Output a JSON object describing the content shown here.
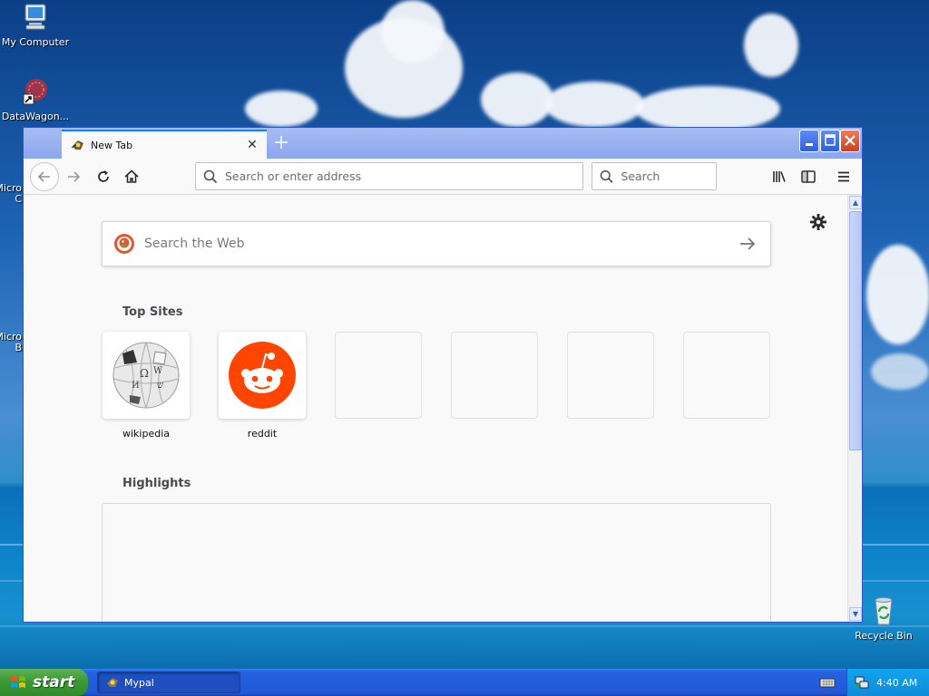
{
  "desktop": {
    "icons": [
      {
        "label": "My Computer"
      },
      {
        "label": "DataWagon..."
      },
      {
        "label": "Micro\nC"
      },
      {
        "label": "Micro\nB"
      },
      {
        "label": "Recycle Bin"
      }
    ]
  },
  "browser": {
    "tab": {
      "title": "New Tab",
      "close": "✕"
    },
    "new_tab": "+",
    "window_buttons": {
      "minimize": "_",
      "maximize": "□",
      "close": "✕"
    },
    "nav": {
      "url_placeholder": "Search or enter address",
      "search_placeholder": "Search"
    },
    "newtab_page": {
      "web_search_placeholder": "Search the Web",
      "top_sites_title": "Top Sites",
      "top_sites": [
        {
          "label": "wikipedia"
        },
        {
          "label": "reddit"
        },
        {
          "label": ""
        },
        {
          "label": ""
        },
        {
          "label": ""
        },
        {
          "label": ""
        }
      ],
      "highlights_title": "Highlights"
    }
  },
  "taskbar": {
    "start_label": "start",
    "task_label": "Mypal",
    "clock": "4:40 AM"
  },
  "colors": {
    "accent": "#0a84ff",
    "reddit": "#ff4500",
    "taskbar": "#2158d8",
    "start": "#3b9a35"
  }
}
